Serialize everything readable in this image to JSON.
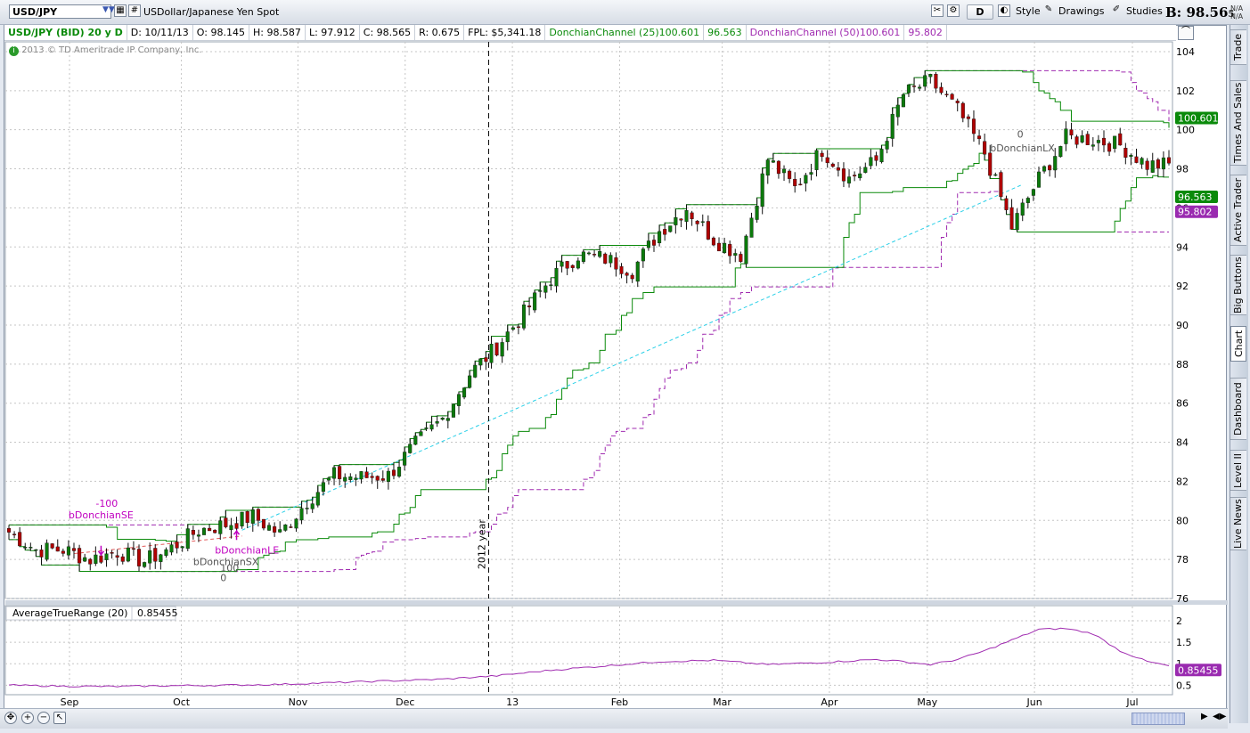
{
  "toolbar": {
    "symbol": "USD/JPY",
    "description": "USDollar/Japanese Yen Spot",
    "period_button": "D",
    "style_label": "Style",
    "drawings_label": "Drawings",
    "studies_label": "Studies",
    "bid_prefix": "B:",
    "bid_value": "98.56",
    "bid_frac": "5",
    "na_top": "N/A",
    "na_bottom": "N/A"
  },
  "header": {
    "instrument": "USD/JPY (BID) 20 y D",
    "date": "D: 10/11/13",
    "open": "O: 98.145",
    "high": "H: 98.587",
    "low": "L: 97.912",
    "close": "C: 98.565",
    "range": "R: 0.675",
    "fpl": "FPL: $5,341.18",
    "dc25_label": "DonchianChannel (25)",
    "dc25_value": "100.601",
    "dc25_lower": "96.563",
    "dc50_label": "DonchianChannel (50)",
    "dc50_value": "100.601",
    "dc50_lower": "95.802"
  },
  "copyright": "2013 © TD Ameritrade IP Company, Inc.",
  "side_tabs": [
    "Trade",
    "Times And Sales",
    "Active Trader",
    "Big Buttons",
    "Chart",
    "Dashboard",
    "Level II",
    "Live News"
  ],
  "active_side_tab": "Chart",
  "colors": {
    "up_candle": "#0b7a0b",
    "down_candle": "#b00000",
    "donchian25": "#0a8a0a",
    "donchian50": "#a02bb0",
    "trendline": "#2ad0e8",
    "atr_line": "#a02bb0",
    "badge_green": "#0a8a0a",
    "badge_purple": "#9a2bb0"
  },
  "chart_data": [
    {
      "type": "candlestick",
      "title": "USD/JPY (BID) 20 y D",
      "x_tick_labels": [
        "Sep",
        "Oct",
        "Nov",
        "Dec",
        "13",
        "Feb",
        "Mar",
        "Apr",
        "May",
        "Jun",
        "Jul"
      ],
      "y_tick_labels": [
        "76",
        "78",
        "80",
        "82",
        "84",
        "86",
        "88",
        "90",
        "92",
        "94",
        "96",
        "98",
        "100",
        "102",
        "104"
      ],
      "ylim": [
        76,
        104.5
      ],
      "grid": true,
      "year_marker_label": "2012 year",
      "weekly_close": [
        [
          0,
          79.4
        ],
        [
          5,
          78.5
        ],
        [
          10,
          78.5
        ],
        [
          15,
          78.0
        ],
        [
          20,
          78.4
        ],
        [
          25,
          77.9
        ],
        [
          30,
          78.6
        ],
        [
          35,
          79.5
        ],
        [
          40,
          79.8
        ],
        [
          45,
          80.2
        ],
        [
          50,
          79.3
        ],
        [
          55,
          81.0
        ],
        [
          60,
          82.3
        ],
        [
          65,
          82.2
        ],
        [
          70,
          82.3
        ],
        [
          75,
          83.9
        ],
        [
          80,
          85.2
        ],
        [
          85,
          87.5
        ],
        [
          90,
          88.9
        ],
        [
          95,
          90.6
        ],
        [
          100,
          92.4
        ],
        [
          105,
          93.6
        ],
        [
          110,
          93.4
        ],
        [
          115,
          92.8
        ],
        [
          120,
          94.8
        ],
        [
          125,
          96.0
        ],
        [
          130,
          94.4
        ],
        [
          135,
          93.6
        ],
        [
          140,
          98.5
        ],
        [
          145,
          97.0
        ],
        [
          150,
          99.0
        ],
        [
          155,
          97.5
        ],
        [
          160,
          98.4
        ],
        [
          165,
          101.8
        ],
        [
          170,
          102.5
        ],
        [
          175,
          101.0
        ],
        [
          180,
          98.8
        ],
        [
          185,
          95.0
        ],
        [
          190,
          97.5
        ],
        [
          195,
          99.6
        ],
        [
          200,
          99.5
        ],
        [
          205,
          99.2
        ],
        [
          210,
          98.2
        ]
      ],
      "series": [
        {
          "name": "DonchianChannel (25)",
          "last_value": 100.601,
          "lower_value": 96.563
        },
        {
          "name": "DonchianChannel (50)",
          "last_value": 100.601,
          "lower_value": 95.802
        }
      ],
      "last_price_badges": [
        "100.601",
        "96.563",
        "95.802"
      ],
      "annotations": [
        "bDonchianSE",
        "-100",
        "bDonchianLE",
        "bDonchianSX",
        "100",
        "0",
        "0",
        "bDonchianLX"
      ]
    },
    {
      "type": "line",
      "title": "AverageTrueRange (20)",
      "value_label": "0.85455",
      "y_tick_labels": [
        "0.5",
        "1",
        "1.5",
        "2"
      ],
      "ylim": [
        0.3,
        2.0
      ],
      "series": [
        {
          "name": "AverageTrueRange (20)",
          "values": [
            [
              0,
              0.5
            ],
            [
              10,
              0.48
            ],
            [
              20,
              0.47
            ],
            [
              30,
              0.49
            ],
            [
              40,
              0.5
            ],
            [
              50,
              0.52
            ],
            [
              60,
              0.56
            ],
            [
              70,
              0.6
            ],
            [
              80,
              0.64
            ],
            [
              90,
              0.72
            ],
            [
              100,
              0.85
            ],
            [
              110,
              0.95
            ],
            [
              120,
              1.05
            ],
            [
              130,
              1.08
            ],
            [
              140,
              0.98
            ],
            [
              150,
              1.03
            ],
            [
              160,
              1.1
            ],
            [
              165,
              1.05
            ],
            [
              170,
              0.98
            ],
            [
              175,
              1.1
            ],
            [
              180,
              1.3
            ],
            [
              185,
              1.55
            ],
            [
              190,
              1.8
            ],
            [
              195,
              1.82
            ],
            [
              200,
              1.7
            ],
            [
              205,
              1.3
            ],
            [
              210,
              1.05
            ],
            [
              214,
              0.95
            ]
          ]
        }
      ]
    }
  ]
}
